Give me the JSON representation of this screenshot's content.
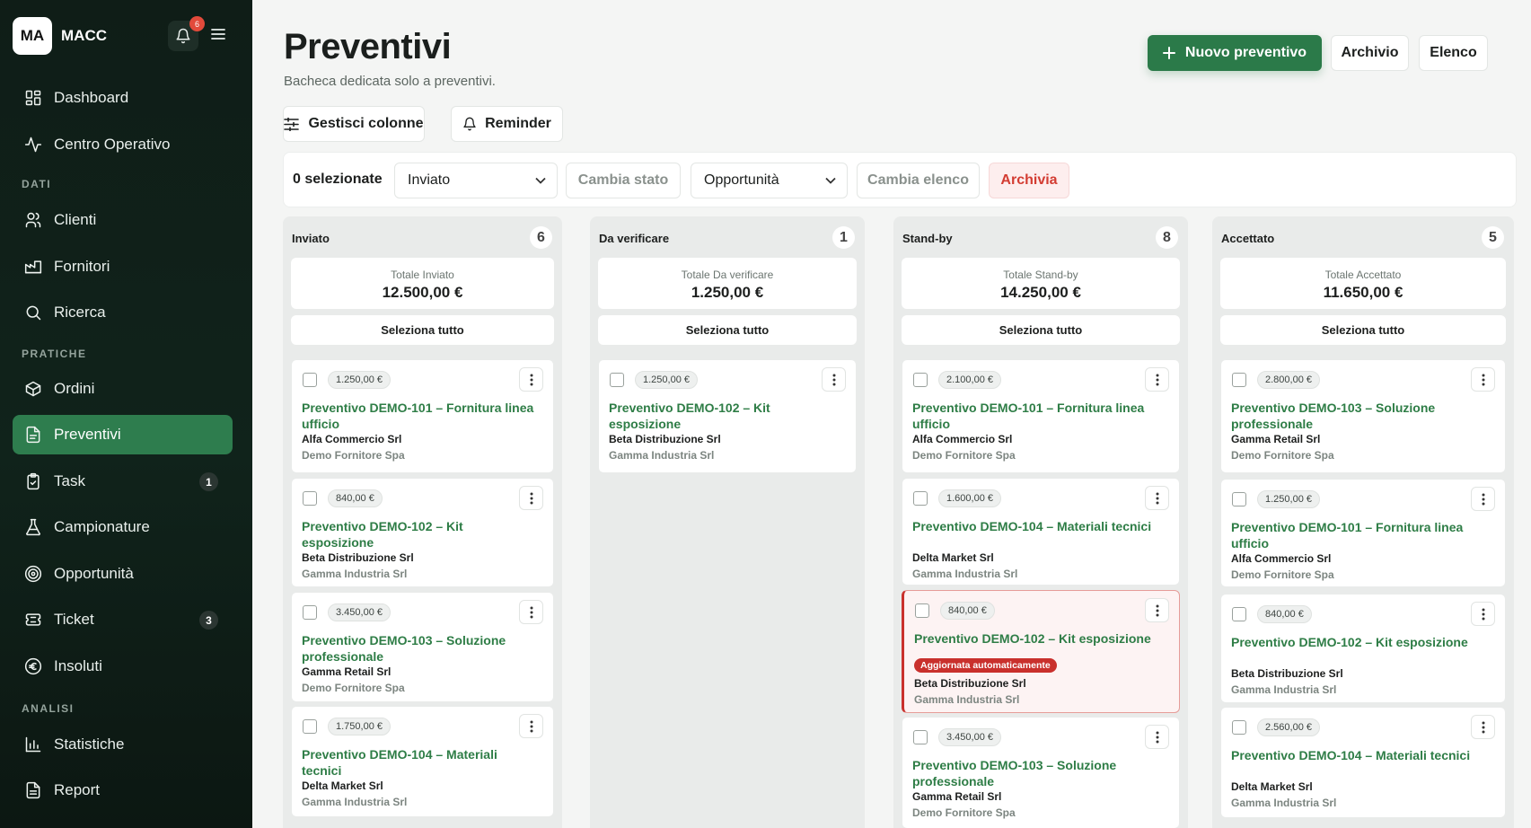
{
  "sidebar": {
    "logo": "MA",
    "app_name": "MACC",
    "notifications": "6",
    "sections": {
      "dati": "DATI",
      "pratiche": "PRATICHE",
      "analisi": "ANALISI"
    },
    "items": [
      {
        "label": "Dashboard",
        "icon": "dashboard-icon"
      },
      {
        "label": "Centro Operativo",
        "icon": "activity-icon"
      },
      {
        "label": "Clienti",
        "icon": "users-icon"
      },
      {
        "label": "Fornitori",
        "icon": "factory-icon"
      },
      {
        "label": "Ricerca",
        "icon": "search-icon"
      },
      {
        "label": "Ordini",
        "icon": "box-icon"
      },
      {
        "label": "Preventivi",
        "icon": "document-icon",
        "active": true
      },
      {
        "label": "Task",
        "icon": "clipboard-icon",
        "badge": "1"
      },
      {
        "label": "Campionature",
        "icon": "flask-icon"
      },
      {
        "label": "Opportunità",
        "icon": "target-icon"
      },
      {
        "label": "Ticket",
        "icon": "ticket-icon",
        "badge": "3"
      },
      {
        "label": "Insoluti",
        "icon": "euro-icon"
      },
      {
        "label": "Statistiche",
        "icon": "bar-chart-icon"
      },
      {
        "label": "Report",
        "icon": "report-icon"
      }
    ]
  },
  "header": {
    "title": "Preventivi",
    "subtitle": "Bacheca dedicata solo a preventivi.",
    "new_button": "Nuovo preventivo",
    "archive_button": "Archivio",
    "list_button": "Elenco",
    "manage_columns": "Gestisci colonne",
    "reminder": "Reminder"
  },
  "toolbar": {
    "selected": "0 selezionate",
    "status_select": "Inviato",
    "change_status": "Cambia stato",
    "list_select": "Opportunità",
    "change_list": "Cambia elenco",
    "archive": "Archivia"
  },
  "select_all": "Seleziona tutto",
  "columns": [
    {
      "title": "Inviato",
      "count": "6",
      "total_label": "Totale Inviato",
      "total": "12.500,00 €",
      "cards": [
        {
          "price": "1.250,00 €",
          "title": "Preventivo DEMO-101 – Fornitura linea ufficio",
          "client": "Alfa Commercio Srl",
          "supplier": "Demo Fornitore Spa"
        },
        {
          "price": "840,00 €",
          "title": "Preventivo DEMO-102 – Kit esposizione",
          "client": "Beta Distribuzione Srl",
          "supplier": "Gamma Industria Srl"
        },
        {
          "price": "3.450,00 €",
          "title": "Preventivo DEMO-103 – Soluzione professionale",
          "client": "Gamma Retail Srl",
          "supplier": "Demo Fornitore Spa"
        },
        {
          "price": "1.750,00 €",
          "title": "Preventivo DEMO-104 – Materiali tecnici",
          "client": "Delta Market Srl",
          "supplier": "Gamma Industria Srl"
        }
      ]
    },
    {
      "title": "Da verificare",
      "count": "1",
      "total_label": "Totale Da verificare",
      "total": "1.250,00 €",
      "cards": [
        {
          "price": "1.250,00 €",
          "title": "Preventivo DEMO-102 – Kit esposizione",
          "client": "Beta Distribuzione Srl",
          "supplier": "Gamma Industria Srl"
        }
      ]
    },
    {
      "title": "Stand-by",
      "count": "8",
      "total_label": "Totale Stand-by",
      "total": "14.250,00 €",
      "cards": [
        {
          "price": "2.100,00 €",
          "title": "Preventivo DEMO-101 – Fornitura linea ufficio",
          "client": "Alfa Commercio Srl",
          "supplier": "Demo Fornitore Spa"
        },
        {
          "price": "1.600,00 €",
          "title": "Preventivo DEMO-104 – Materiali tecnici",
          "client": "Delta Market Srl",
          "supplier": "Gamma Industria Srl"
        },
        {
          "price": "840,00 €",
          "title": "Preventivo DEMO-102 – Kit esposizione",
          "tag": "Aggiornata automaticamente",
          "client": "Beta Distribuzione Srl",
          "supplier": "Gamma Industria Srl"
        },
        {
          "price": "3.450,00 €",
          "title": "Preventivo DEMO-103 – Soluzione professionale",
          "client": "Gamma Retail Srl",
          "supplier": "Demo Fornitore Spa"
        }
      ]
    },
    {
      "title": "Accettato",
      "count": "5",
      "total_label": "Totale Accettato",
      "total": "11.650,00 €",
      "cards": [
        {
          "price": "2.800,00 €",
          "title": "Preventivo DEMO-103 – Soluzione professionale",
          "client": "Gamma Retail Srl",
          "supplier": "Demo Fornitore Spa"
        },
        {
          "price": "1.250,00 €",
          "title": "Preventivo DEMO-101 – Fornitura linea ufficio",
          "client": "Alfa Commercio Srl",
          "supplier": "Demo Fornitore Spa"
        },
        {
          "price": "840,00 €",
          "title": "Preventivo DEMO-102 – Kit esposizione",
          "client": "Beta Distribuzione Srl",
          "supplier": "Gamma Industria Srl"
        },
        {
          "price": "2.560,00 €",
          "title": "Preventivo DEMO-104 – Materiali tecnici",
          "client": "Delta Market Srl",
          "supplier": "Gamma Industria Srl"
        }
      ]
    }
  ]
}
